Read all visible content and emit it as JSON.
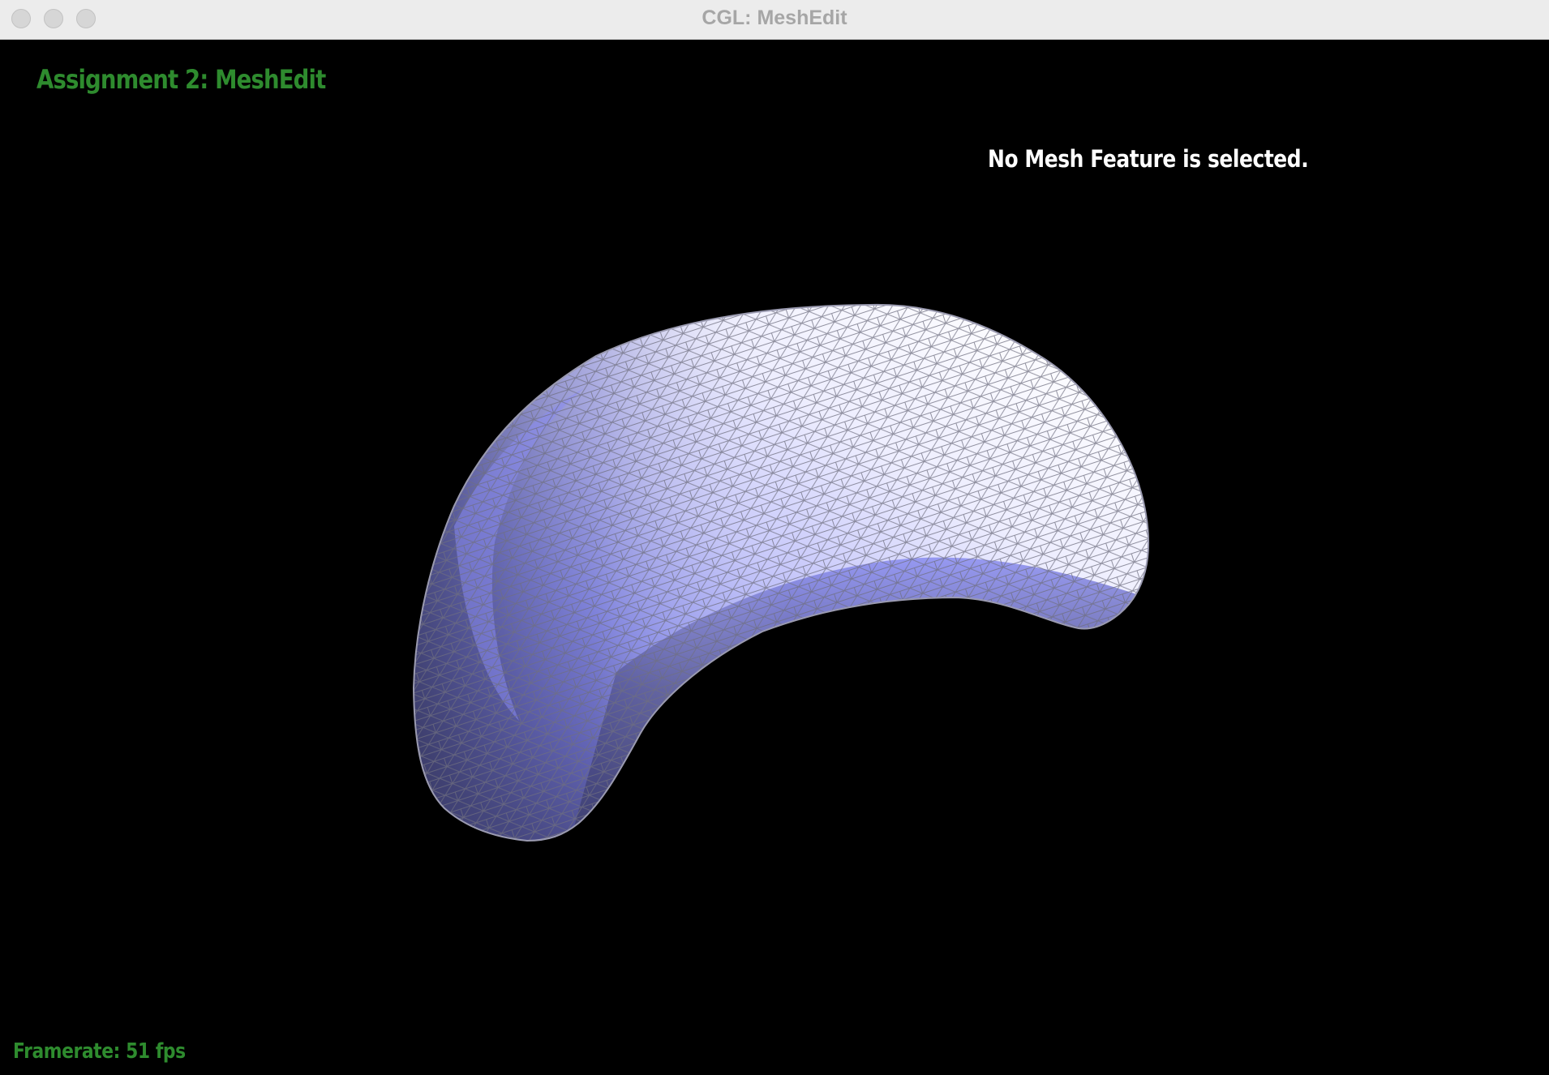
{
  "window": {
    "title": "CGL: MeshEdit"
  },
  "hud": {
    "app_title": "Assignment 2: MeshEdit",
    "selection_status": "No Mesh Feature is selected.",
    "framerate": "Framerate: 51 fps"
  },
  "colors": {
    "background": "#000000",
    "hud_green": "#2e8b2e",
    "hud_white": "#ffffff",
    "mesh_light": "#f4f4ff",
    "mesh_mid": "#8a8df0",
    "mesh_dark": "#2a2a48",
    "wire": "#6e6e7e"
  },
  "icons": {
    "close": "close-traffic-light",
    "minimize": "minimize-traffic-light",
    "zoom": "zoom-traffic-light"
  }
}
